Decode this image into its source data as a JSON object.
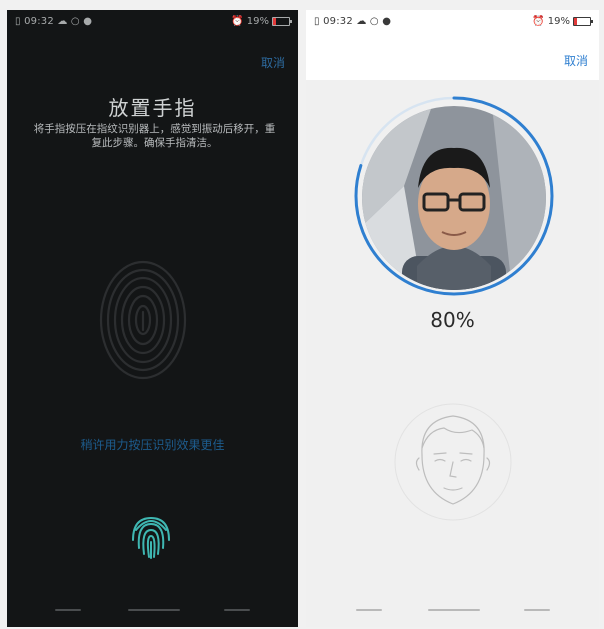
{
  "fingerprint_screen": {
    "status": {
      "time": "09:32",
      "battery": "19%",
      "battery_level": 0.19
    },
    "cancel_label": "取消",
    "title": "放置手指",
    "description": "将手指按压在指纹识别器上，感觉到振动后移开，重复此步骤。确保手指清洁。",
    "hint": "稍许用力按压识别效果更佳"
  },
  "face_screen": {
    "status": {
      "time": "09:32",
      "battery": "19%",
      "battery_level": 0.19
    },
    "cancel_label": "取消",
    "progress_text": "80%",
    "progress_value": 0.8
  },
  "colors": {
    "accent_blue": "#2f7fd0",
    "fingerprint_bg": "#131516",
    "battery_low": "#e23a3a",
    "sensor_teal": "#3fb7b2"
  },
  "icons": [
    "sim-icon",
    "cloud-icon",
    "circle-icon",
    "shield-icon",
    "alarm-icon",
    "battery-icon",
    "fingerprint-icon",
    "face-outline-icon"
  ]
}
